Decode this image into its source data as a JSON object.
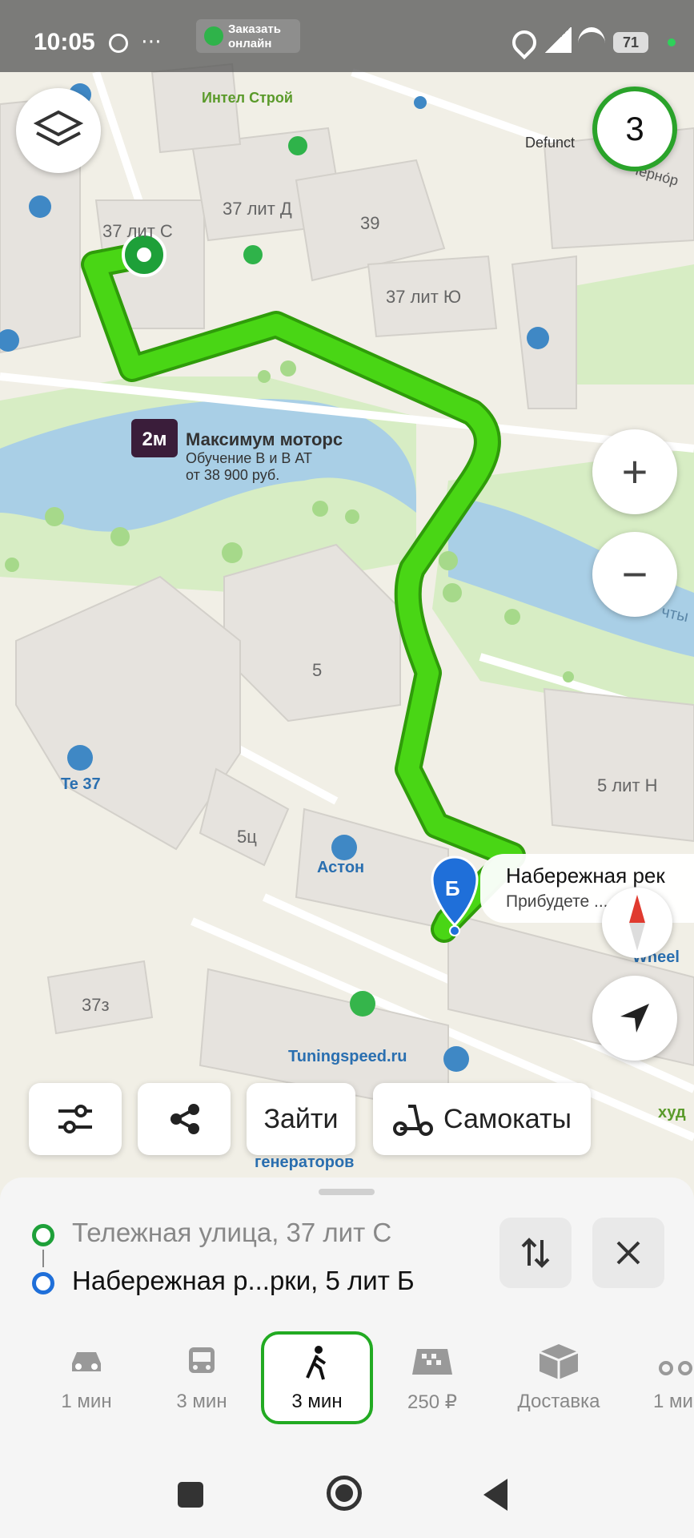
{
  "status_bar": {
    "time": "10:05",
    "order_label": "Заказать онлайн",
    "battery": "71"
  },
  "map": {
    "labels": {
      "intel": "Интел Строй",
      "defunct": "Defunct",
      "chernor": "Черно́р",
      "b37c": "37 лит С",
      "b37d": "37 лит Д",
      "b39": "39",
      "b37yu": "37 лит Ю",
      "maximum_title": "Максимум моторс",
      "maximum_line1": "Обучение В и В АТ",
      "maximum_line2": "от 38 900 руб.",
      "b5": "5",
      "te37": "Te 37",
      "b5ts": "5ц",
      "aston": "Астон",
      "b5n": "5 лит Н",
      "b37z": "37з",
      "tuning": "Tuningspeed.ru",
      "wheel": "Wheel",
      "generators": "генераторов",
      "hud": "худ",
      "chty": "чты",
      "dest_badge": "Б"
    },
    "dest_card": {
      "title": "Набережная рек",
      "subtitle": "Прибудете ... 9"
    },
    "traffic_level": "3"
  },
  "chips": {
    "go_label": "Зайти",
    "scooters_label": "Самокаты"
  },
  "route": {
    "from": "Тележная улица, 37 лит С",
    "to": "Набережная р...рки, 5 лит Б"
  },
  "modes": [
    {
      "icon": "car-icon",
      "label": "1 мин"
    },
    {
      "icon": "bus-icon",
      "label": "3 мин"
    },
    {
      "icon": "walk-icon",
      "label": "3 мин"
    },
    {
      "icon": "taxi-icon",
      "label": "250 ₽"
    },
    {
      "icon": "box-icon",
      "label": "Доставка"
    },
    {
      "icon": "scooter-icon",
      "label": "1 ми"
    }
  ],
  "colors": {
    "route": "#3ec10f",
    "water": "#a9cfe6",
    "park": "#d7edc4",
    "building": "#e6e3de",
    "accent_green": "#22aa22",
    "dest_blue": "#1f6fd9"
  }
}
